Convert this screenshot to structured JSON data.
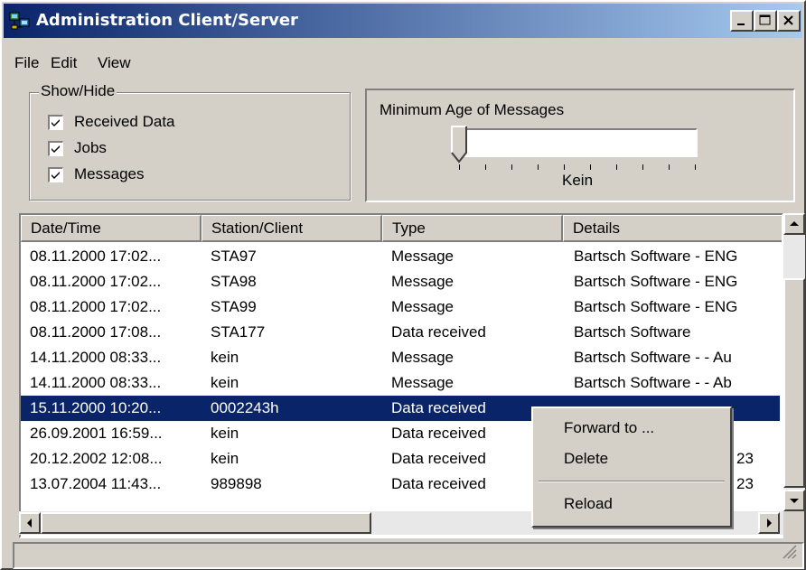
{
  "window": {
    "title": "Administration Client/Server"
  },
  "menu": {
    "file": "File",
    "edit": "Edit",
    "view": "View"
  },
  "show_hide": {
    "title": "Show/Hide",
    "items": [
      {
        "label": "Received Data",
        "checked": true
      },
      {
        "label": "Jobs",
        "checked": true
      },
      {
        "label": "Messages",
        "checked": true
      }
    ]
  },
  "min_age": {
    "title": "Minimum Age of Messages",
    "value_label": "Kein",
    "slider_position": 0
  },
  "table": {
    "columns": [
      "Date/Time",
      "Station/Client",
      "Type",
      "Details"
    ],
    "rows": [
      {
        "date": "08.11.2000 17:02...",
        "station": "STA97",
        "type": "Message",
        "details": "Bartsch Software - ENG"
      },
      {
        "date": "08.11.2000 17:02...",
        "station": "STA98",
        "type": "Message",
        "details": "Bartsch Software - ENG"
      },
      {
        "date": "08.11.2000 17:02...",
        "station": "STA99",
        "type": "Message",
        "details": "Bartsch Software - ENG"
      },
      {
        "date": "08.11.2000 17:08...",
        "station": "STA177",
        "type": "Data received",
        "details": "Bartsch Software"
      },
      {
        "date": "14.11.2000 08:33...",
        "station": "kein",
        "type": "Message",
        "details": "Bartsch Software -  - Au"
      },
      {
        "date": "14.11.2000 08:33...",
        "station": "kein",
        "type": "Message",
        "details": "Bartsch Software -  - Ab"
      },
      {
        "date": "15.11.2000 10:20...",
        "station": "0002243h",
        "type": "Data received",
        "details": "",
        "selected": true
      },
      {
        "date": "26.09.2001 16:59...",
        "station": "kein",
        "type": "Data received",
        "details": ""
      },
      {
        "date": "20.12.2002 12:08...",
        "station": "kein",
        "type": "Data received",
        "details": "23"
      },
      {
        "date": "13.07.2004 11:43...",
        "station": "989898",
        "type": "Data received",
        "details": "23"
      }
    ]
  },
  "context_menu": {
    "forward": "Forward to ...",
    "delete": "Delete",
    "reload": "Reload"
  },
  "colors": {
    "title_start": "#0a246a",
    "title_end": "#a6caf0",
    "selection": "#0a246a",
    "face": "#d4d0c8"
  }
}
